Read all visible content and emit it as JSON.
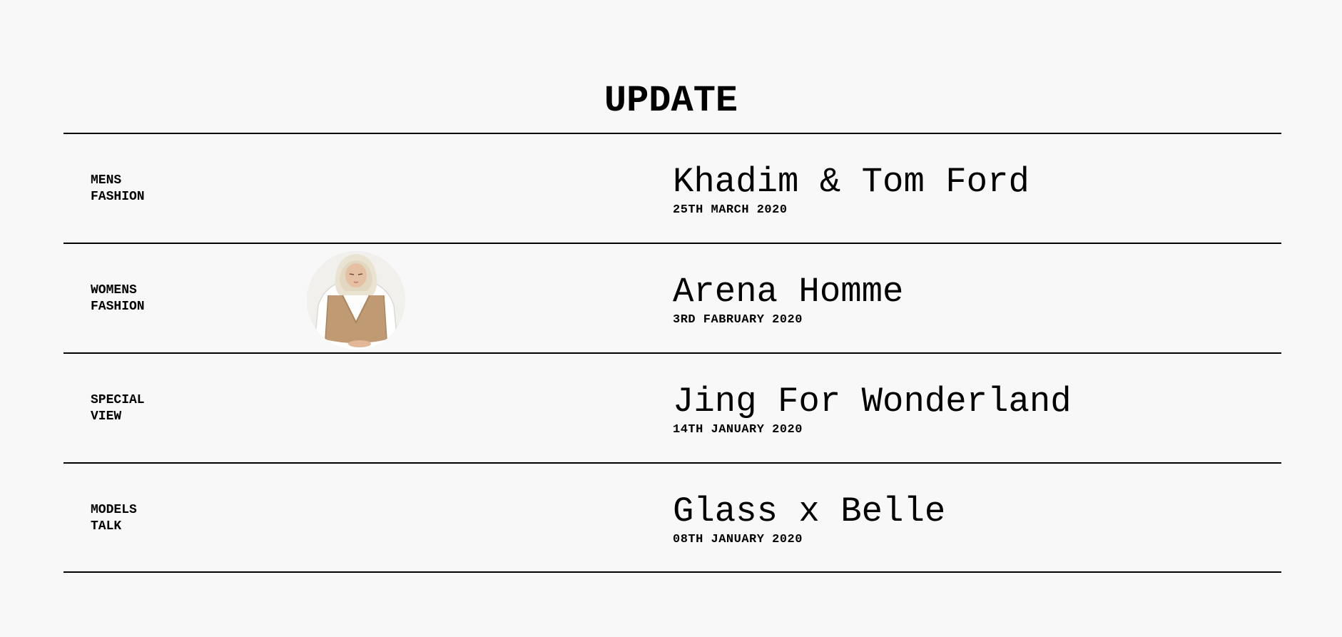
{
  "page": {
    "title": "UPDATE"
  },
  "items": [
    {
      "category": "MENS\nFASHION",
      "headline": "Khadim & Tom Ford",
      "date": "25TH MARCH 2020",
      "has_thumbnail": false
    },
    {
      "category": "WOMENS\nFASHION",
      "headline": "Arena Homme",
      "date": "3RD FABRUARY 2020",
      "has_thumbnail": true,
      "thumbnail_icon": "hijab-model-photo"
    },
    {
      "category": "SPECIAL\nVIEW",
      "headline": "Jing For Wonderland",
      "date": "14TH JANUARY 2020",
      "has_thumbnail": false
    },
    {
      "category": "MODELS\nTALK",
      "headline": "Glass x Belle",
      "date": "08TH JANUARY 2020",
      "has_thumbnail": false
    }
  ],
  "colors": {
    "background": "#f8f8f8",
    "text": "#000000",
    "divider": "#000000"
  }
}
